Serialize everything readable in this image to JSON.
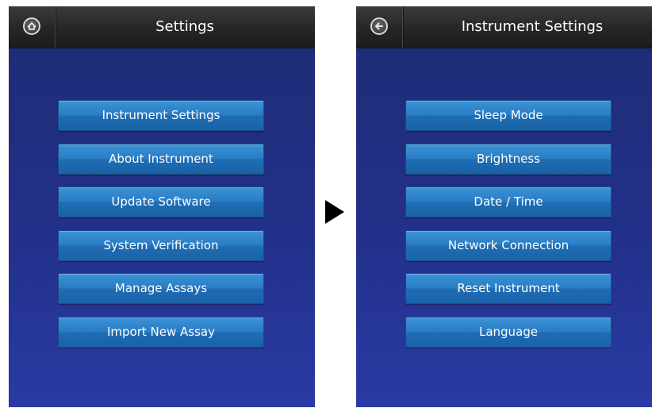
{
  "left_screen": {
    "title": "Settings",
    "nav_icon": "home-icon",
    "buttons": [
      "Instrument Settings",
      "About Instrument",
      "Update Software",
      "System Verification",
      "Manage Assays",
      "Import New Assay"
    ]
  },
  "right_screen": {
    "title": "Instrument Settings",
    "nav_icon": "back-arrow-icon",
    "buttons": [
      "Sleep Mode",
      "Brightness",
      "Date / Time",
      "Network Connection",
      "Reset Instrument",
      "Language"
    ]
  },
  "transition_icon": "play-arrow-icon",
  "colors": {
    "screen_background": "#223089",
    "button": "#2a7cc4",
    "topbar": "#262626",
    "text": "#ffffff"
  }
}
